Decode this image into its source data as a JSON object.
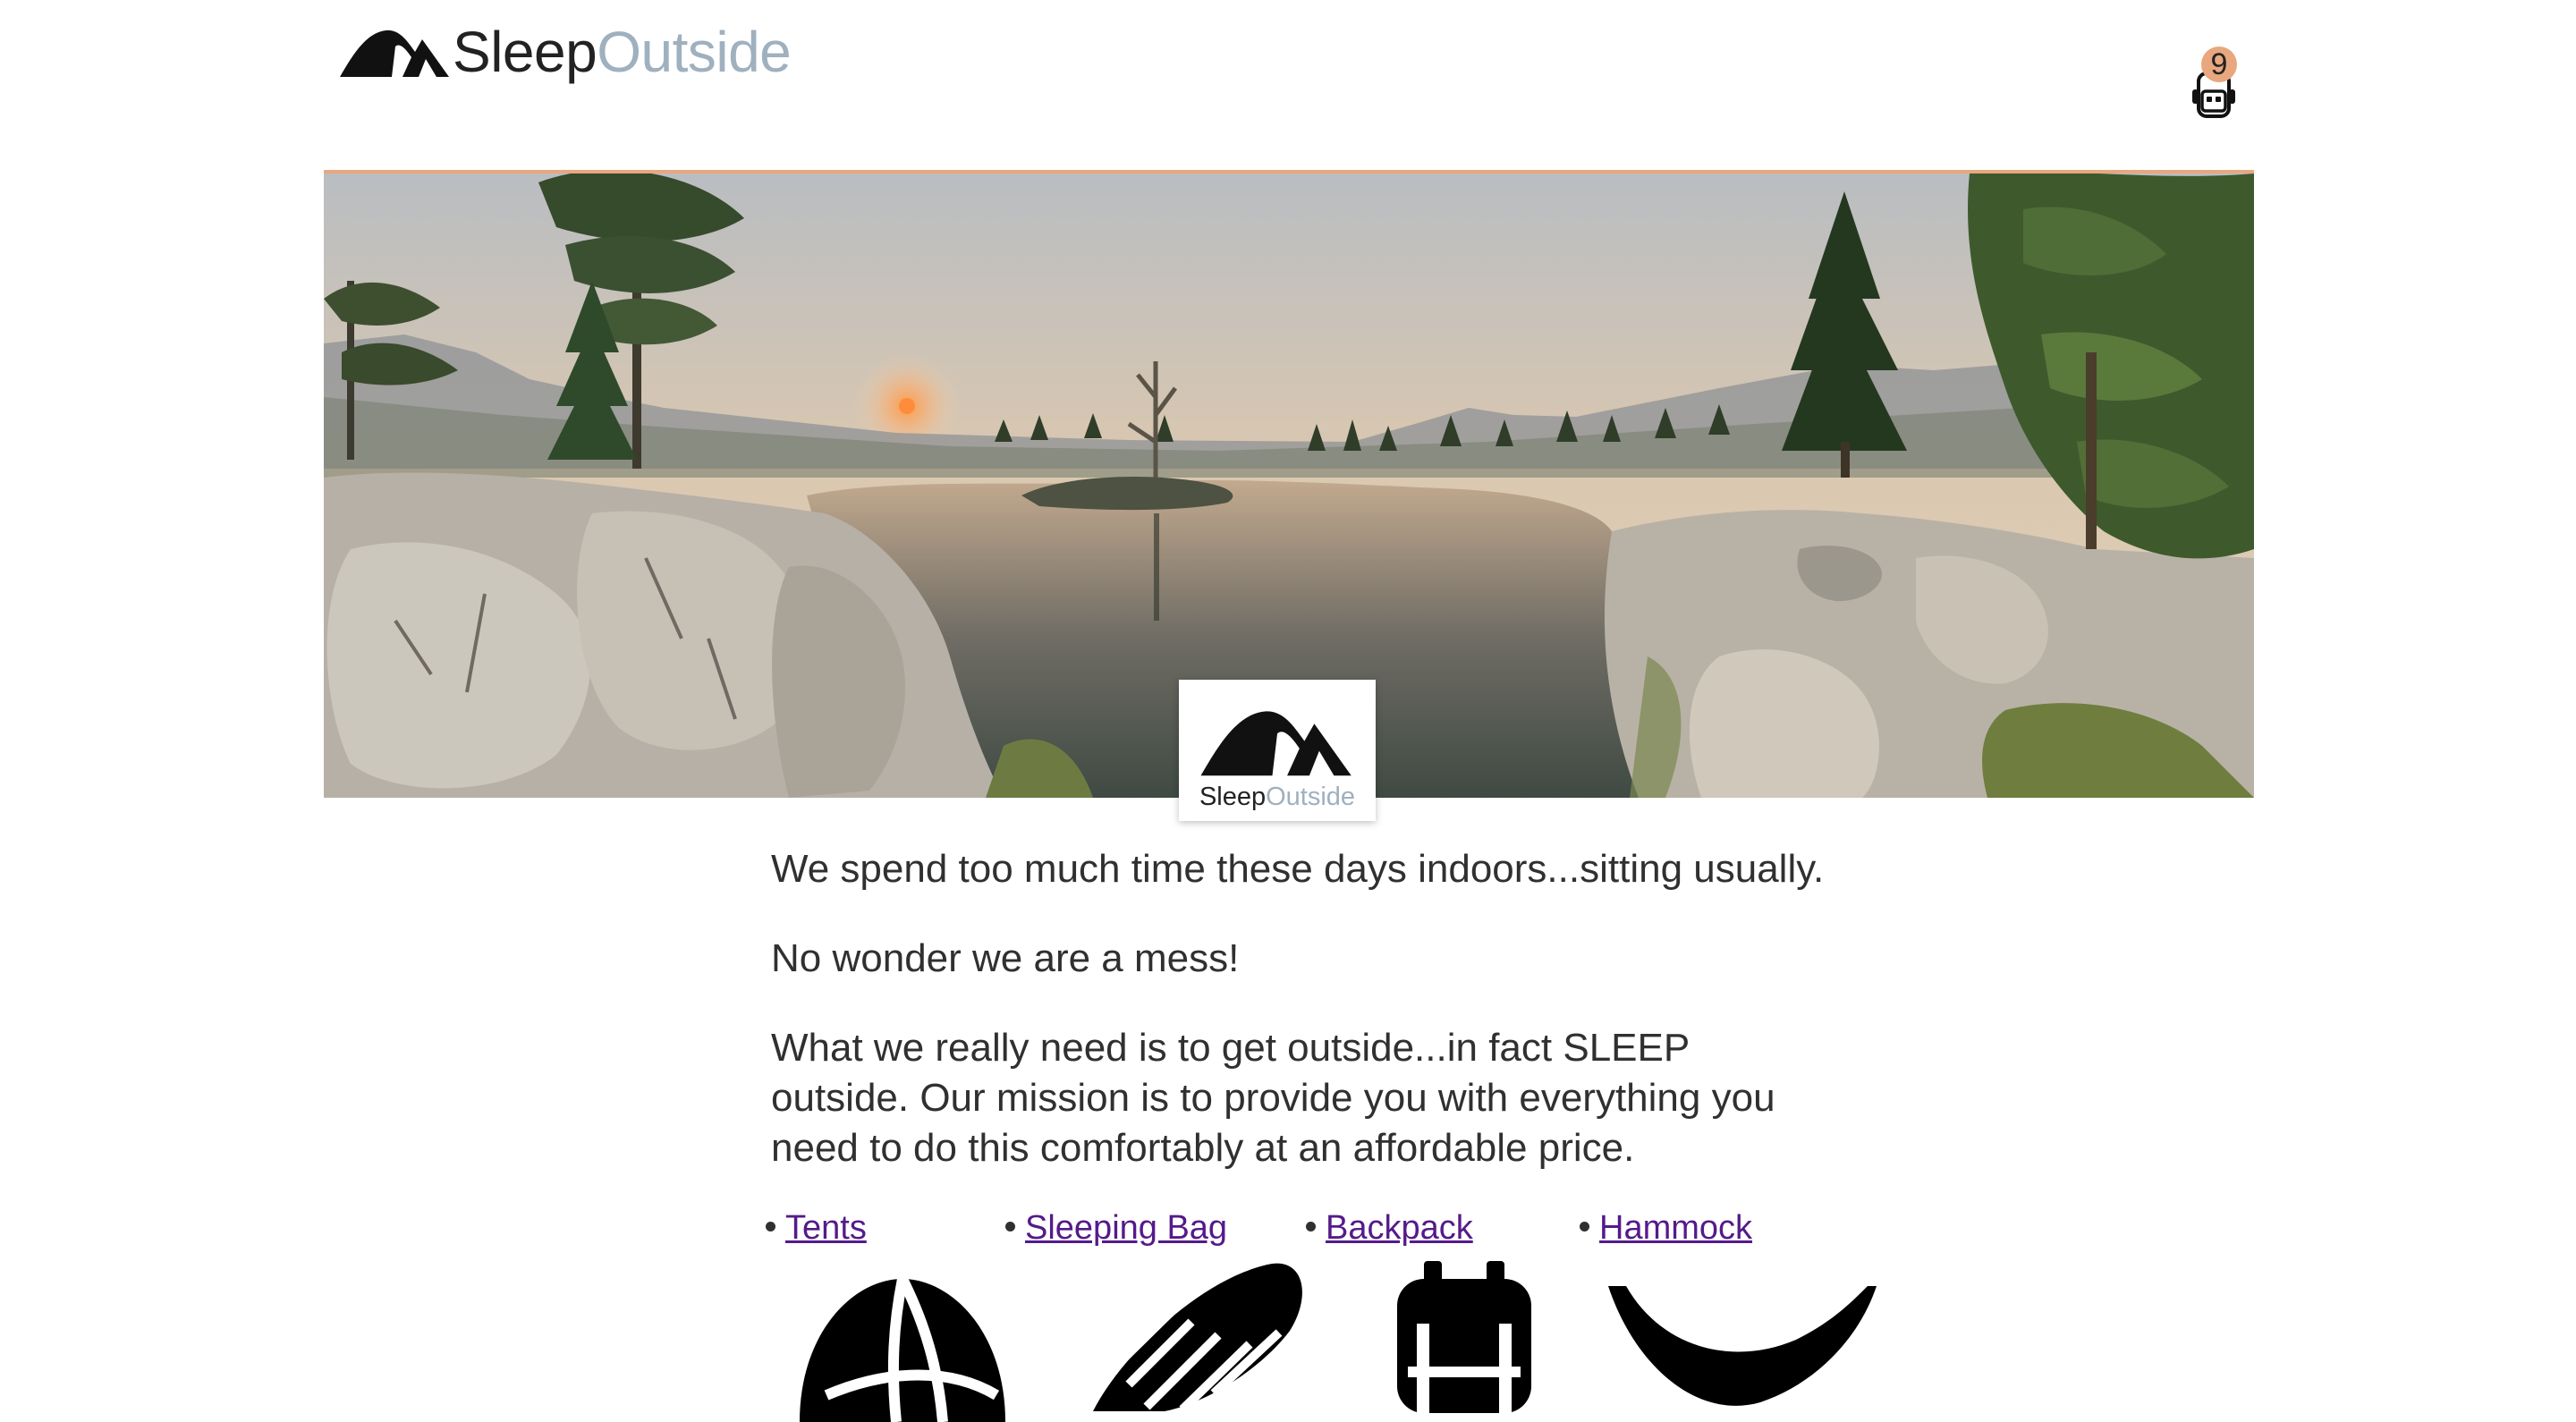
{
  "header": {
    "logo_text_dark": "Sleep",
    "logo_text_light": "Outside",
    "logo_icon": "tent-logo-icon",
    "cart_icon": "backpack-cart-icon",
    "cart_count": "9"
  },
  "hero": {
    "image": "mountain-lake-sunset-image",
    "badge_text_dark": "Sleep",
    "badge_text_light": "Outside"
  },
  "mission": {
    "paragraphs": [
      "We spend too much time these days indoors...sitting usually.",
      "No wonder we are a mess!",
      "What we really need is to get outside...in fact SLEEP outside. Our mission is to provide you with everything you need to do this comfortably at an affordable price."
    ]
  },
  "products": [
    {
      "label": "Tents",
      "icon": "tent-icon"
    },
    {
      "label": "Sleeping Bag",
      "icon": "sleeping-bag-icon"
    },
    {
      "label": "Backpack",
      "icon": "backpack-icon"
    },
    {
      "label": "Hammock",
      "icon": "hammock-icon"
    }
  ],
  "colors": {
    "accent": "#e8a77e",
    "logo_light": "#9fb0bf",
    "link_visited": "#551a8b",
    "text": "#303030"
  }
}
